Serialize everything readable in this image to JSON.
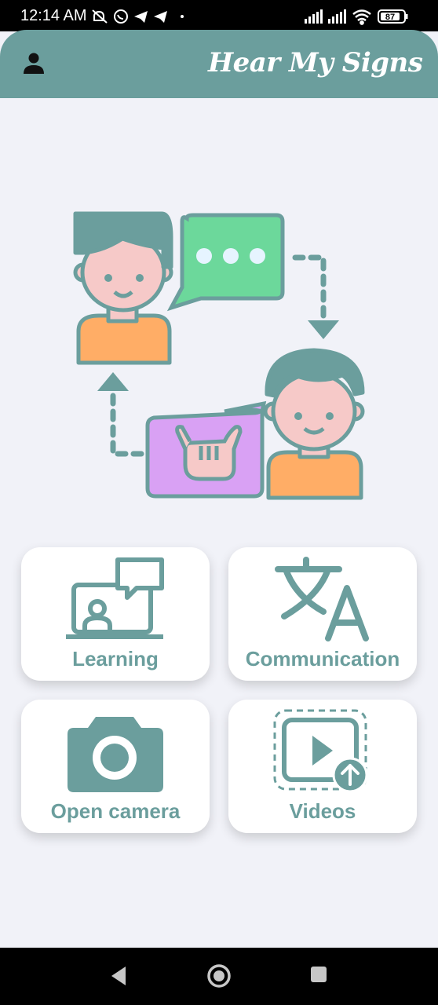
{
  "status_bar": {
    "time": "12:14 AM",
    "battery": "87",
    "left_icons": [
      "mute-icon",
      "whatsapp-icon",
      "telegram-icon",
      "telegram-icon",
      "dot-icon"
    ],
    "right_icons": [
      "signal-icon",
      "signal-icon",
      "wifi-icon",
      "battery-icon"
    ]
  },
  "app_bar": {
    "title": "Hear My Signs",
    "profile_icon": "person-icon"
  },
  "hero": {
    "icon": "sign-language-conversation-illustration",
    "colors": {
      "teal": "#6b9e9d",
      "skin": "#f6c9c8",
      "shirt": "#ffad66",
      "speech_bubble": "#6cd89b",
      "sign_bubble": "#d9a1f4"
    }
  },
  "cards": [
    {
      "label": "Learning",
      "icon": "learning-icon"
    },
    {
      "label": "Communication",
      "icon": "translate-icon"
    },
    {
      "label": "Open camera",
      "icon": "camera-icon"
    },
    {
      "label": "Videos",
      "icon": "video-upload-icon"
    }
  ],
  "nav_bar": {
    "buttons": [
      "back-icon",
      "home-icon",
      "recents-icon"
    ]
  },
  "theme": {
    "accent": "#6b9e9d",
    "background": "#f1f2f8"
  }
}
